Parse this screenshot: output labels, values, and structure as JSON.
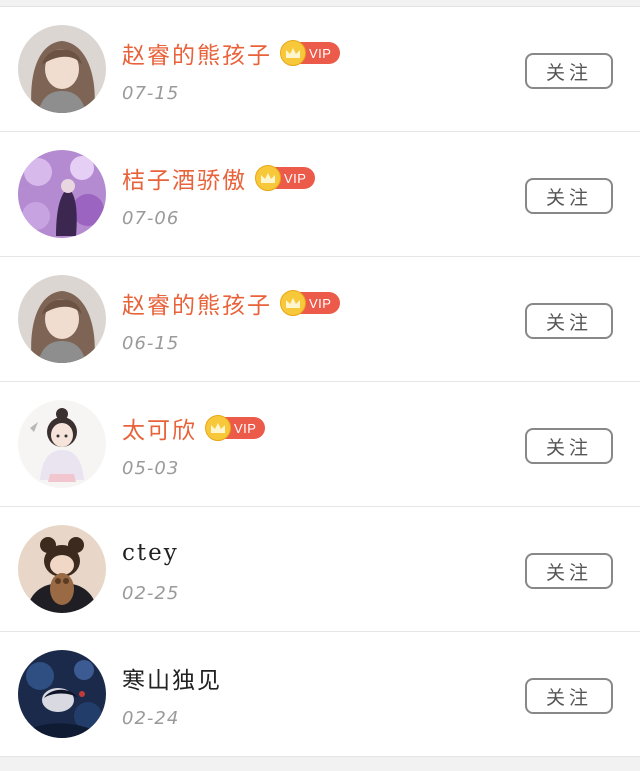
{
  "colors": {
    "vip_name": "#e8623a",
    "vip_badge": "#ec5a4a",
    "crown": "#f7c93a",
    "date": "#9a9a9a",
    "button_border": "#888888"
  },
  "follow_label": "关注",
  "vip_label": "VIP",
  "users": [
    {
      "name": "赵睿的熊孩子",
      "vip": true,
      "date": "07-15",
      "avatar": "girl-brown-hair"
    },
    {
      "name": "桔子酒骄傲",
      "vip": true,
      "date": "07-06",
      "avatar": "purple-flowers"
    },
    {
      "name": "赵睿的熊孩子",
      "vip": true,
      "date": "06-15",
      "avatar": "girl-brown-hair"
    },
    {
      "name": "太可欣",
      "vip": true,
      "date": "05-03",
      "avatar": "cartoon-girl"
    },
    {
      "name": "ctey",
      "vip": false,
      "date": "02-25",
      "avatar": "teddy-bear-person"
    },
    {
      "name": "寒山独见",
      "vip": false,
      "date": "02-24",
      "avatar": "dark-blue-art"
    }
  ]
}
